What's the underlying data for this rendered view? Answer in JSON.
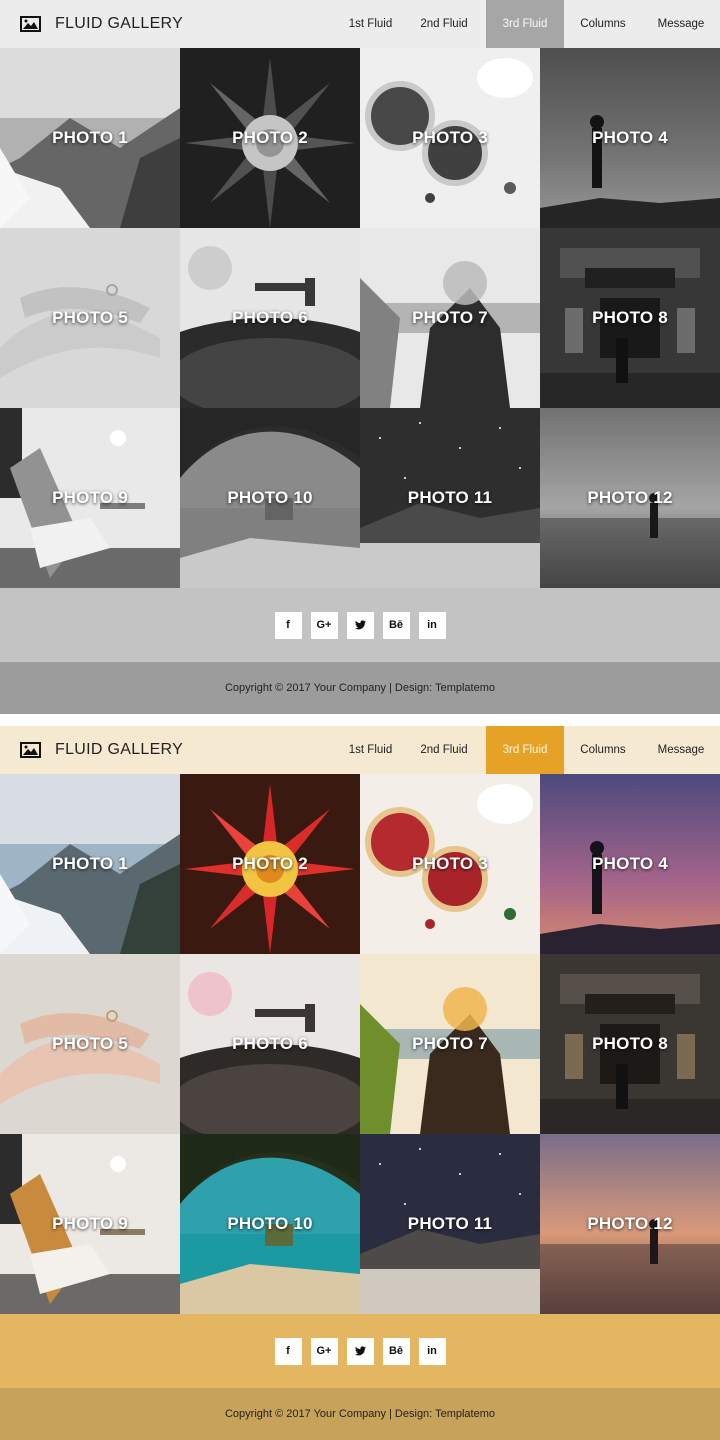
{
  "brand": {
    "title": "FLUID GALLERY",
    "icon": "picture-icon"
  },
  "nav": {
    "links": [
      "1st Fluid",
      "2nd Fluid",
      "3rd Fluid",
      "Columns",
      "Message"
    ],
    "active": "3rd Fluid"
  },
  "photos": [
    "PHOTO 1",
    "PHOTO 2",
    "PHOTO 3",
    "PHOTO 4",
    "PHOTO 5",
    "PHOTO 6",
    "PHOTO 7",
    "PHOTO 8",
    "PHOTO 9",
    "PHOTO 10",
    "PHOTO 11",
    "PHOTO 12"
  ],
  "social": {
    "facebook": "f",
    "google_plus": "G+",
    "twitter": "twitter-bird-icon",
    "behance": "Bē",
    "linkedin": "in"
  },
  "footer": {
    "copyright": "Copyright © 2017 Your Company | Design: Templatemo"
  },
  "colors": {
    "gray_navbar": "#ececec",
    "gray_active": "#a6a6a6",
    "gray_social_bar": "#c3c3c3",
    "gray_footer": "#9c9c9c",
    "color_navbar": "#f6e9d2",
    "color_active": "#e5a227",
    "color_social_bar": "#e4b662",
    "color_footer": "#c7a25a"
  }
}
